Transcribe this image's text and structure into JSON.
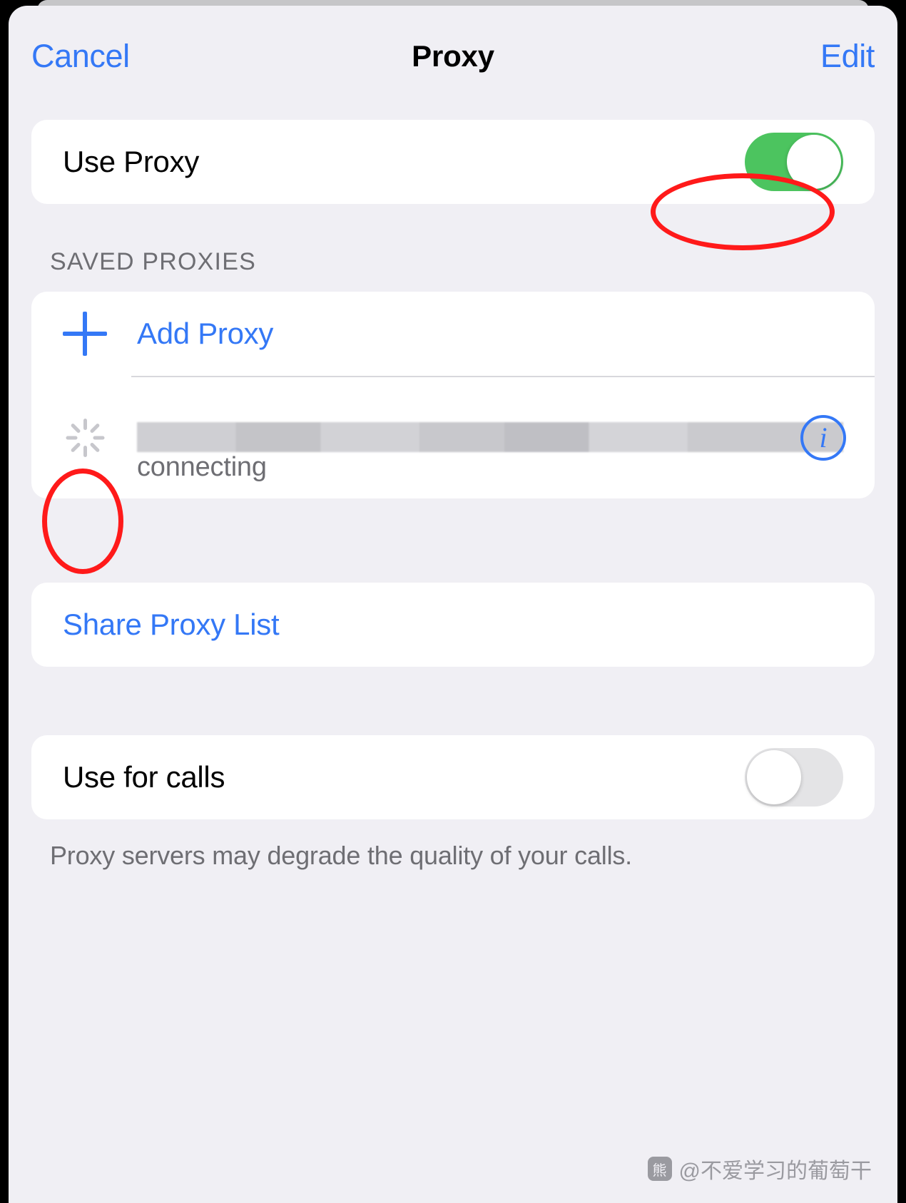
{
  "nav": {
    "cancel_label": "Cancel",
    "title": "Proxy",
    "edit_label": "Edit"
  },
  "use_proxy": {
    "label": "Use Proxy",
    "toggle_state": "on",
    "accent_on": "#4cc45f"
  },
  "saved_proxies": {
    "section_header": "SAVED PROXIES",
    "add_label": "Add Proxy",
    "entry": {
      "name": "",
      "status": "connecting",
      "info_glyph": "i"
    }
  },
  "share": {
    "label": "Share Proxy List"
  },
  "calls": {
    "label": "Use for calls",
    "toggle_state": "off",
    "footer": "Proxy servers may degrade the quality of your calls."
  },
  "annotations": {
    "color": "#ff1a1a",
    "items": [
      "use-proxy-toggle",
      "proxy-status-spinner"
    ]
  },
  "watermark": {
    "logo": "熊",
    "text": "@不爱学习的葡萄干"
  }
}
